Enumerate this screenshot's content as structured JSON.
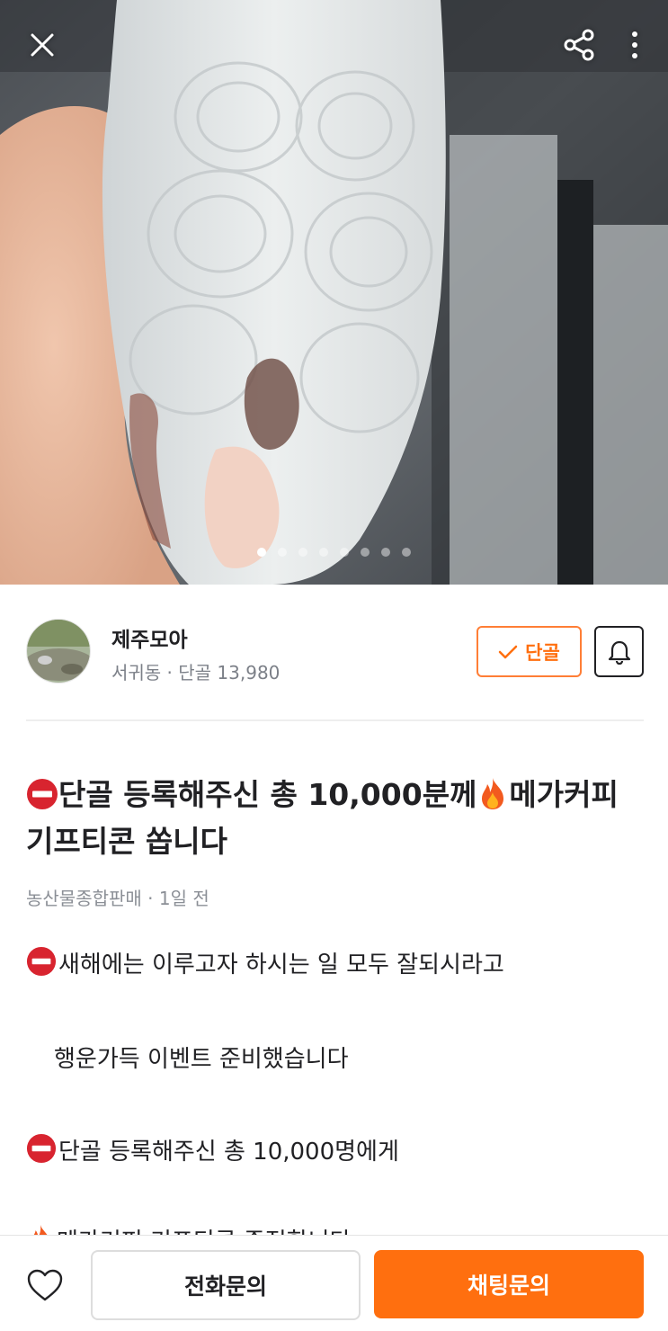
{
  "header": {
    "close_icon": "close-icon",
    "share_icon": "share-icon",
    "more_icon": "more-vertical-icon"
  },
  "gallery": {
    "image_count": 8,
    "current_index": 1
  },
  "seller": {
    "name": "제주모아",
    "meta": "서귀동 · 단골 13,980",
    "follow_label": "단골",
    "follow_icon": "check-icon",
    "bell_icon": "bell-icon"
  },
  "post": {
    "title_part1": "단골 등록해주신 총 10,000분께",
    "title_part2": "메가커피 기프티콘 쏩니다",
    "meta": "농산물종합판매 · 1일 전",
    "lines": [
      "새해에는 이루고자 하시는 일 모두 잘되시라고",
      "행운가득 이벤트 준비했습니다",
      "단골 등록해주신 총 10,000명에게",
      "메가커피 기프티콘 증정합니다"
    ]
  },
  "bottom_bar": {
    "heart_icon": "heart-icon",
    "call_label": "전화문의",
    "chat_label": "채팅문의"
  },
  "colors": {
    "accent": "#ff6f0f",
    "accent_border": "#ff7e36",
    "text_primary": "#212124",
    "text_secondary": "#7c8088"
  }
}
